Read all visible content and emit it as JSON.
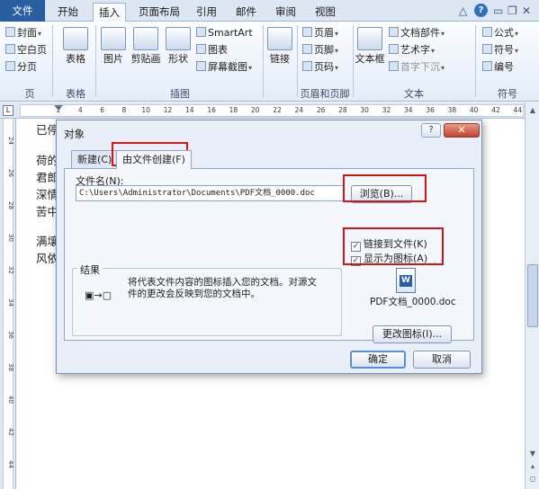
{
  "ribbon": {
    "tabs": [
      {
        "label": "文件"
      },
      {
        "label": "开始"
      },
      {
        "label": "插入"
      },
      {
        "label": "页面布局"
      },
      {
        "label": "引用"
      },
      {
        "label": "邮件"
      },
      {
        "label": "审阅"
      },
      {
        "label": "视图"
      }
    ],
    "window_controls": {
      "expand": "△",
      "help": "?",
      "minimize": "▭",
      "restore": "❐",
      "close": "✕"
    },
    "pages_group": {
      "cover": "封面",
      "blank": "空白页",
      "break": "分页",
      "label": "页"
    },
    "table_group": {
      "table": "表格",
      "label": "表格"
    },
    "illustrations_group": {
      "picture": "图片",
      "clipart": "剪贴画",
      "shapes": "形状",
      "smartart": "SmartArt",
      "chart": "图表",
      "screenshot": "屏幕截图",
      "label": "插图"
    },
    "links_group": {
      "link": "链接"
    },
    "header_footer_group": {
      "header": "页眉",
      "footer": "页脚",
      "page_number": "页码",
      "label": "页眉和页脚"
    },
    "text_group": {
      "textbox": "文本框",
      "quickparts": "文档部件",
      "wordart": "艺术字",
      "dropcap": "首字下沉",
      "label": "文本"
    },
    "symbols_group": {
      "equation": "公式",
      "symbol": "符号",
      "number": "编号",
      "label": "符号"
    }
  },
  "ruler": {
    "corner": "L",
    "marks": [
      "2",
      "4",
      "6",
      "8",
      "10",
      "12",
      "14",
      "16",
      "18",
      "20",
      "22",
      "24",
      "26",
      "28",
      "30",
      "32",
      "34",
      "36",
      "38",
      "40",
      "42",
      "44"
    ],
    "vertical_marks": [
      "24",
      "26",
      "28",
      "30",
      "32",
      "34",
      "36",
      "38",
      "40",
      "42",
      "44"
    ]
  },
  "document": {
    "lines": [
      "已停",
      "荷的",
      "君郎",
      "深情",
      "苦中",
      "满壤",
      "风依"
    ]
  },
  "dialog": {
    "title": "对象",
    "help": "?",
    "close": "✕",
    "tabs": [
      {
        "label": "新建(C)"
      },
      {
        "label": "由文件创建(F)"
      }
    ],
    "file_name_label": "文件名(N):",
    "file_path": "C:\\Users\\Administrator\\Documents\\PDF文档_0000.doc",
    "browse_button": "浏览(B)...",
    "link_to_file": {
      "label": "链接到文件(K)",
      "checked": "✓"
    },
    "display_as_icon": {
      "label": "显示为图标(A)",
      "checked": "✓"
    },
    "result_label": "结果",
    "result_text": "将代表文件内容的图标插入您的文档。对源文件的更改会反映到您的文档中。",
    "result_icon": "▣→▢",
    "preview_doc_glyph": "W",
    "preview_caption": "PDF文档_0000.doc",
    "change_icon_button": "更改图标(I)...",
    "ok_button": "确定",
    "cancel_button": "取消"
  },
  "colors": {
    "file_tab": "#2a5ea3",
    "highlight": "#d8141b",
    "dialog_bg": "#e9eff8"
  }
}
